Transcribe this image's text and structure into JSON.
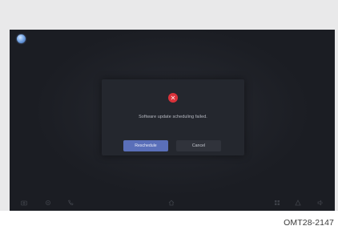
{
  "dialog": {
    "message": "Software update scheduling failed.",
    "primary_label": "Reschedule",
    "secondary_label": "Cancel",
    "icon": "error-x-icon",
    "accent_color": "#5a6fb9",
    "error_color": "#d9323a"
  },
  "taskbar": {
    "icons": [
      "camera-icon",
      "settings-icon",
      "phone-icon",
      "home-icon",
      "apps-icon",
      "mic-icon",
      "volume-icon"
    ]
  },
  "caption": {
    "code": "OMT28-2147"
  }
}
